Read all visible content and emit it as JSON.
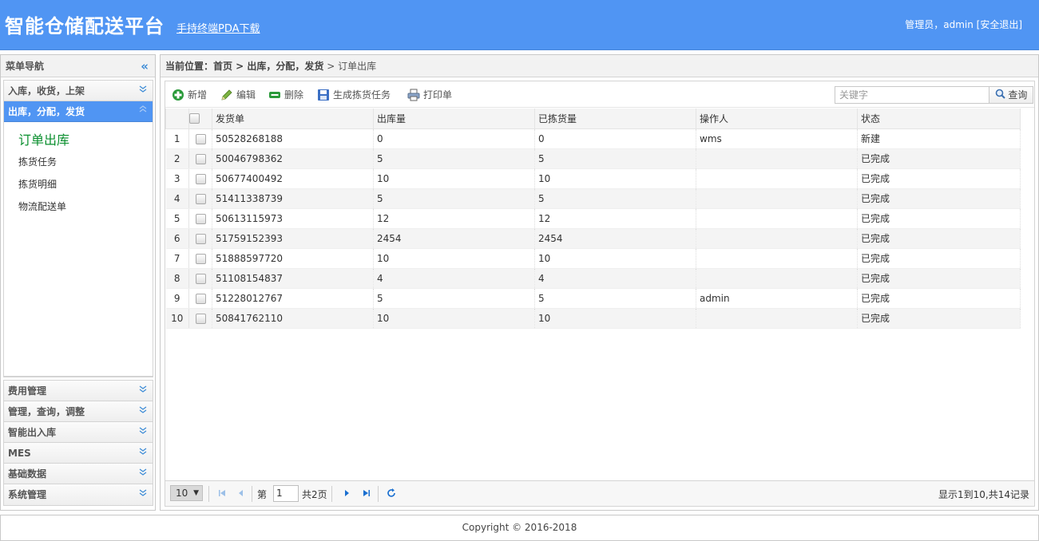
{
  "header": {
    "title": "智能仓储配送平台",
    "pda_link": "手持终端PDA下载",
    "user_info": "管理员，admin [安全退出]"
  },
  "sidebar": {
    "title": "菜单导航",
    "sections": [
      {
        "label": "入库，收货，上架"
      },
      {
        "label": "出库，分配，发货",
        "items": [
          "订单出库",
          "拣货任务",
          "拣货明细",
          "物流配送单"
        ]
      },
      {
        "label": "费用管理"
      },
      {
        "label": "管理，查询，调整"
      },
      {
        "label": "智能出入库"
      },
      {
        "label": "MES"
      },
      {
        "label": "基础数据"
      },
      {
        "label": "系统管理"
      }
    ]
  },
  "breadcrumb": {
    "prefix": "当前位置：首页 > ",
    "section": "出库，分配，发货",
    "sep": " > ",
    "page": "订单出库"
  },
  "toolbar": {
    "add": "新增",
    "edit": "编辑",
    "delete": "删除",
    "gen_task": "生成拣货任务",
    "print": "打印单",
    "search_placeholder": "关键字",
    "search_btn": "查询"
  },
  "table": {
    "columns": [
      "发货单",
      "出库量",
      "已拣货量",
      "操作人",
      "状态"
    ],
    "rows": [
      {
        "n": "1",
        "order": "50528268188",
        "qty": "0",
        "picked": "0",
        "operator": "wms",
        "status": "新建"
      },
      {
        "n": "2",
        "order": "50046798362",
        "qty": "5",
        "picked": "5",
        "operator": "",
        "status": "已完成"
      },
      {
        "n": "3",
        "order": "50677400492",
        "qty": "10",
        "picked": "10",
        "operator": "",
        "status": "已完成"
      },
      {
        "n": "4",
        "order": "51411338739",
        "qty": "5",
        "picked": "5",
        "operator": "",
        "status": "已完成"
      },
      {
        "n": "5",
        "order": "50613115973",
        "qty": "12",
        "picked": "12",
        "operator": "",
        "status": "已完成"
      },
      {
        "n": "6",
        "order": "51759152393",
        "qty": "2454",
        "picked": "2454",
        "operator": "",
        "status": "已完成"
      },
      {
        "n": "7",
        "order": "51888597720",
        "qty": "10",
        "picked": "10",
        "operator": "",
        "status": "已完成"
      },
      {
        "n": "8",
        "order": "51108154837",
        "qty": "4",
        "picked": "4",
        "operator": "",
        "status": "已完成"
      },
      {
        "n": "9",
        "order": "51228012767",
        "qty": "5",
        "picked": "5",
        "operator": "admin",
        "status": "已完成"
      },
      {
        "n": "10",
        "order": "50841762110",
        "qty": "10",
        "picked": "10",
        "operator": "",
        "status": "已完成"
      }
    ]
  },
  "pager": {
    "page_size": "10",
    "page_prefix": "第",
    "page_value": "1",
    "page_total": "共2页",
    "info": "显示1到10,共14记录"
  },
  "footer": {
    "copyright": "Copyright © 2016-2018"
  },
  "colors": {
    "header_bg": "#5095f3",
    "active_item": "#0a8f2e"
  }
}
